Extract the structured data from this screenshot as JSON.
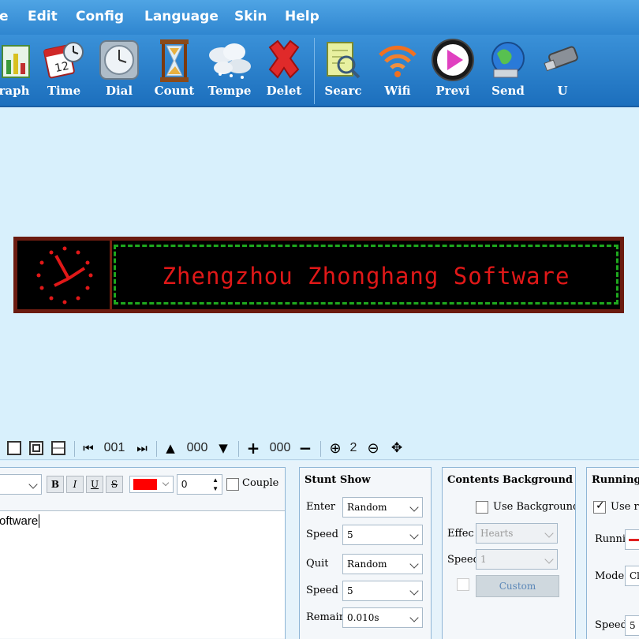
{
  "menu": [
    "e",
    "Edit",
    "Config",
    "Language",
    "Skin",
    "Help"
  ],
  "toolbar": [
    {
      "label": "raph",
      "icon": "graph-icon"
    },
    {
      "label": "Time",
      "icon": "calendar-clock-icon"
    },
    {
      "label": "Dial",
      "icon": "dial-clock-icon"
    },
    {
      "label": "Count",
      "icon": "hourglass-icon"
    },
    {
      "label": "Tempe",
      "icon": "cloud-temperature-icon"
    },
    {
      "label": "Delet",
      "icon": "delete-x-icon"
    },
    {
      "label": "Searc",
      "icon": "search-icon"
    },
    {
      "label": "Wifi",
      "icon": "wifi-icon"
    },
    {
      "label": "Previ",
      "icon": "play-preview-icon"
    },
    {
      "label": "Send",
      "icon": "globe-send-icon"
    },
    {
      "label": "U",
      "icon": "usb-drive-icon"
    }
  ],
  "led": {
    "text": "Zhengzhou Zhonghang Software"
  },
  "strip": {
    "frame": "001",
    "offset_y": "000",
    "offset_x": "000",
    "zoom": "2"
  },
  "text_panel": {
    "color_value": "0",
    "couple_label": "Couple",
    "content": "oftware"
  },
  "stunt": {
    "title": "Stunt Show",
    "enter_label": "Enter",
    "enter_value": "Random",
    "speed1_label": "Speed",
    "speed1_value": "5",
    "quit_label": "Quit",
    "quit_value": "Random",
    "speed2_label": "Speed",
    "speed2_value": "5",
    "remain_label": "Remair",
    "remain_value": "0.010s"
  },
  "background": {
    "title": "Contents Background",
    "use_label": "Use Background",
    "effect_label": "Effec",
    "effect_value": "Hearts",
    "speed_label": "Speed",
    "speed_value": "1",
    "custom_label": "Custom"
  },
  "running": {
    "title": "Running",
    "use_label": "Use r",
    "running_label": "Runni",
    "mode_label": "Mode",
    "mode_value": "Cl",
    "speed_label": "Speed",
    "speed_value": "5"
  },
  "colors": {
    "menubar": "#2f86d0",
    "led_text": "#e01818",
    "led_border": "#1ea81e",
    "text_color_swatch": "#ff0000"
  }
}
